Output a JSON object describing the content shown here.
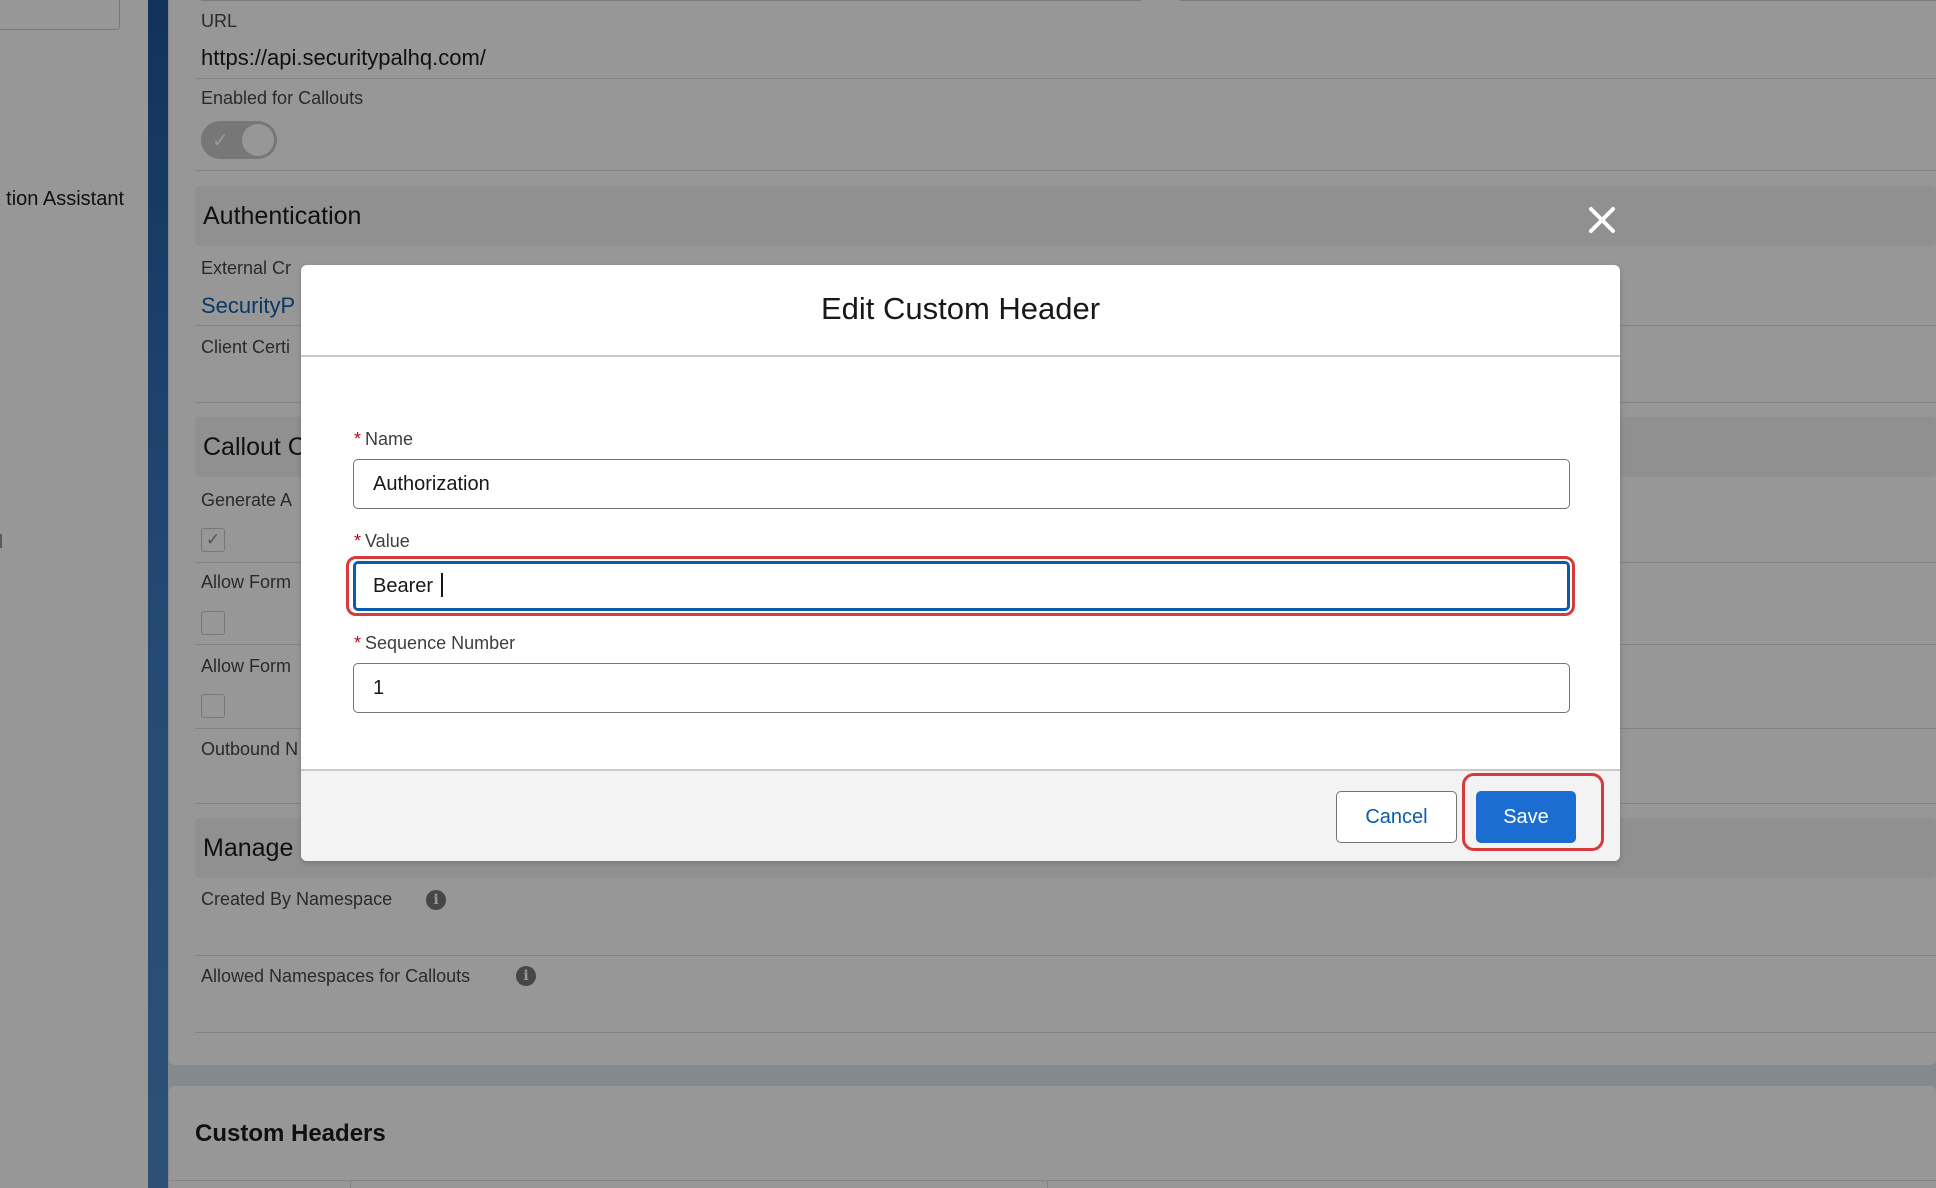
{
  "nav": {
    "item_label": "tion Assistant"
  },
  "page": {
    "url_label": "URL",
    "url_value": "https://api.securitypalhq.com/",
    "callouts_label": "Enabled for Callouts",
    "callouts_enabled": true,
    "auth_section": "Authentication",
    "ext_cred_label": "External Cr",
    "ext_cred_value": "SecurityP",
    "client_cert_label": "Client Certi",
    "callout_section": "Callout C",
    "generate_label": "Generate A",
    "generate_checked": true,
    "allow_form_1_label": "Allow Form",
    "allow_form_2_label": "Allow Form",
    "outbound_label": "Outbound N",
    "managed_section": "Manage",
    "created_ns_label": "Created By Namespace",
    "allowed_ns_label": "Allowed Namespaces for Callouts",
    "custom_headers_title": "Custom Headers"
  },
  "modal": {
    "title": "Edit Custom Header",
    "name_label": "Name",
    "name_value": "Authorization",
    "value_label": "Value",
    "value_value": "Bearer ",
    "sequence_label": "Sequence Number",
    "sequence_value": "1",
    "required_marker": "*",
    "cancel_label": "Cancel",
    "save_label": "Save"
  },
  "colors": {
    "brand_blue": "#1b6dd1",
    "link_blue": "#0b5cab",
    "highlight_red": "#d63b3b",
    "required_red": "#ba0517"
  },
  "icons": {
    "close": "close-icon",
    "info": "info-icon",
    "check": "checkmark-icon"
  }
}
